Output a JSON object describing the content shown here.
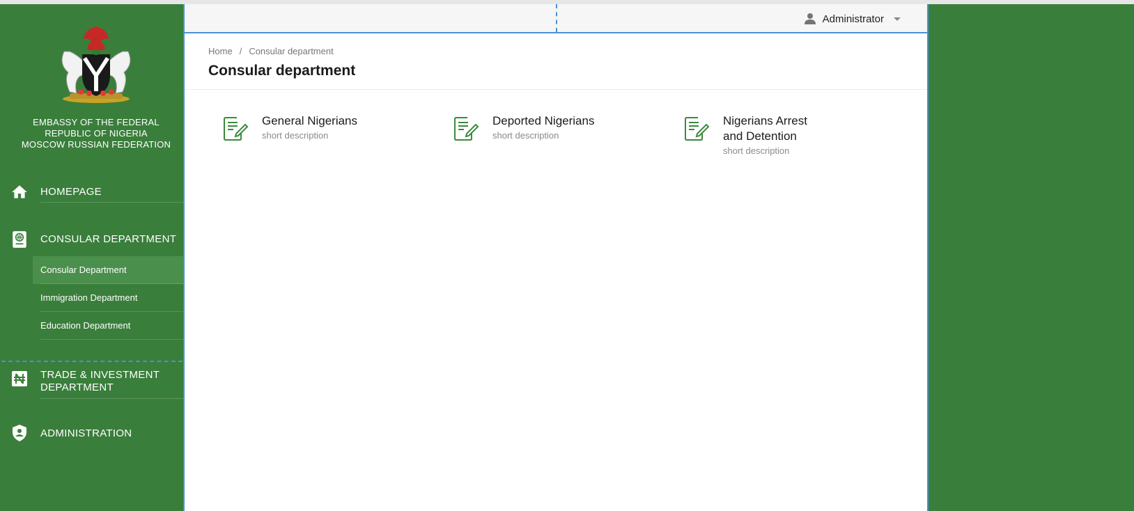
{
  "sidebar": {
    "embassy_lines": [
      "Embassy of the Federal",
      "Republic of Nigeria",
      "Moscow Russian Federation"
    ],
    "nav": [
      {
        "label": "Homepage",
        "icon": "home-icon"
      },
      {
        "label": "Consular Department",
        "icon": "passport-icon"
      },
      {
        "label": "Trade & Investment Department",
        "icon": "naira-icon"
      },
      {
        "label": "Administration",
        "icon": "shield-user-icon"
      }
    ],
    "consular_sub": [
      {
        "label": "Consular Department",
        "active": true
      },
      {
        "label": "Immigration Department",
        "active": false
      },
      {
        "label": "Education Department",
        "active": false
      }
    ],
    "trade_lines": [
      "Trade & Investment",
      "Department"
    ]
  },
  "header": {
    "user_name": "Administrator"
  },
  "breadcrumb": {
    "home": "Home",
    "separator": "/",
    "current": "Consular department"
  },
  "page": {
    "title": "Consular department"
  },
  "cards": [
    {
      "title_lines": [
        "General Nigerians"
      ],
      "description": "short description"
    },
    {
      "title_lines": [
        "Deported Nigerians"
      ],
      "description": "short description"
    },
    {
      "title_lines": [
        "Nigerians Arrest",
        "and Detention"
      ],
      "description": "short description"
    }
  ],
  "colors": {
    "brand_green": "#3a7e3b",
    "active_sub": "#4b8f4d",
    "selection_blue": "#4a90d9"
  }
}
